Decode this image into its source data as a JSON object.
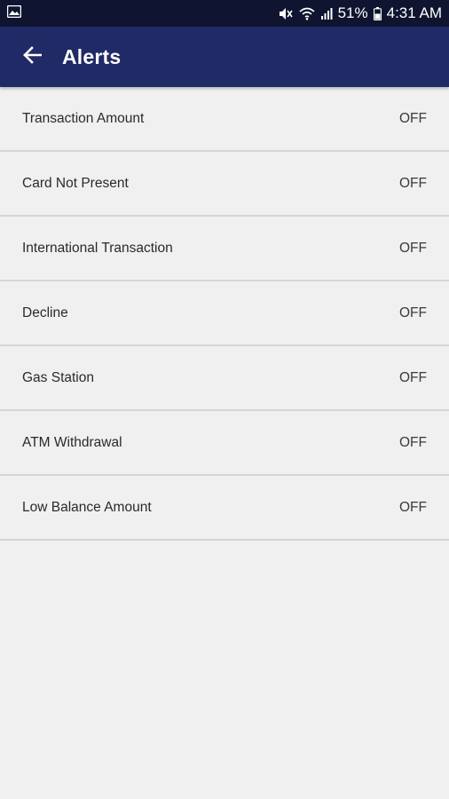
{
  "status_bar": {
    "battery": "51%",
    "time": "4:31 AM",
    "icons": [
      "image-icon",
      "mute-icon",
      "wifi-icon",
      "signal-icon",
      "battery-icon"
    ]
  },
  "app_bar": {
    "title": "Alerts",
    "back_icon": "arrow-left-icon"
  },
  "alerts": [
    {
      "label": "Transaction Amount",
      "value": "OFF"
    },
    {
      "label": "Card Not Present",
      "value": "OFF"
    },
    {
      "label": "International Transaction",
      "value": "OFF"
    },
    {
      "label": "Decline",
      "value": "OFF"
    },
    {
      "label": "Gas Station",
      "value": "OFF"
    },
    {
      "label": "ATM Withdrawal",
      "value": "OFF"
    },
    {
      "label": "Low Balance Amount",
      "value": "OFF"
    }
  ],
  "colors": {
    "status_bar": "#0f1530",
    "app_bar": "#1f2a66",
    "background": "#f0f0f0"
  }
}
